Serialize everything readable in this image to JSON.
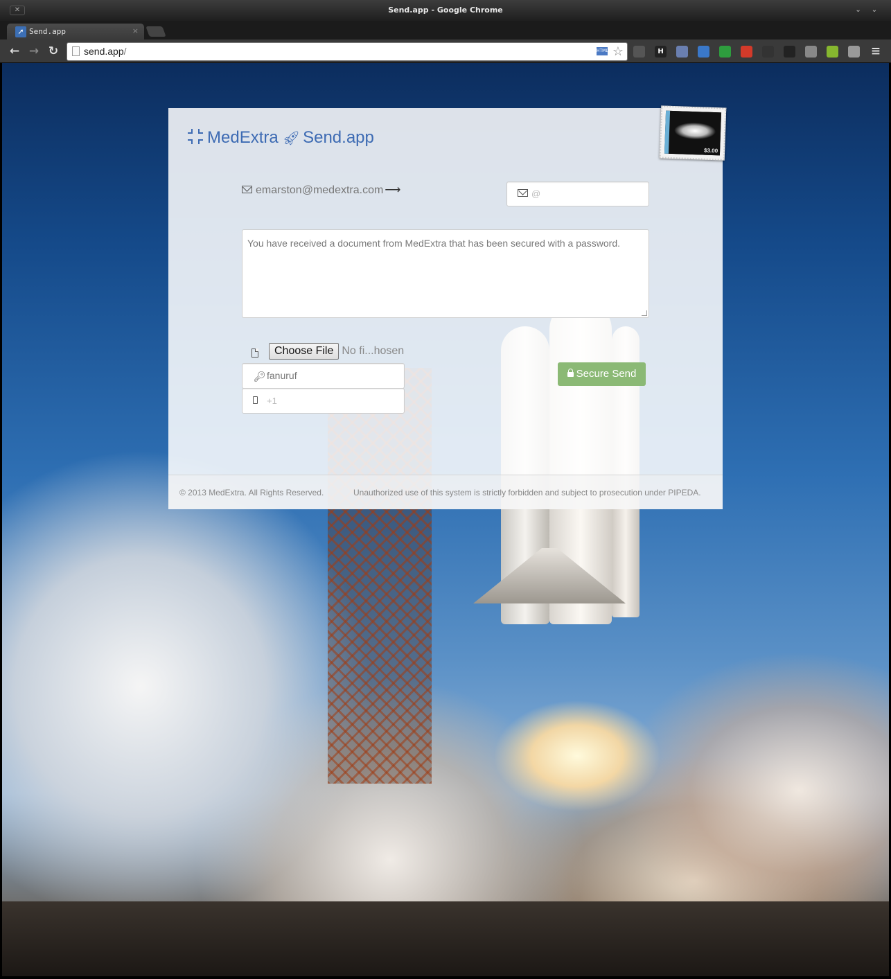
{
  "window": {
    "title": "Send.app - Google Chrome",
    "close_glyph": "✕",
    "min_glyph": "⌄",
    "max_glyph": "⌄"
  },
  "tabs": [
    {
      "title": "Send.app",
      "close": "×",
      "favicon": "rocket-favicon"
    }
  ],
  "toolbar": {
    "back": "←",
    "forward": "→",
    "reload": "↻",
    "url_host": "send.app",
    "url_path": "/",
    "star": "☆",
    "menu": "≡",
    "extensions": [
      {
        "icon": "recycle-icon",
        "color": "#555555"
      },
      {
        "icon": "h-extension-icon",
        "label": "H",
        "color": "#222222"
      },
      {
        "icon": "printer-icon",
        "color": "#6a7fb0"
      },
      {
        "icon": "window-icon",
        "color": "#3a78c9"
      },
      {
        "icon": "badge-green-icon",
        "color": "#2e9d3e"
      },
      {
        "icon": "puzzle-icon",
        "color": "#d33a2a"
      },
      {
        "icon": "clock-icon",
        "color": "#333333"
      },
      {
        "icon": "circle-arrow-icon",
        "color": "#222222"
      },
      {
        "icon": "bar-icon",
        "color": "#888888"
      },
      {
        "icon": "android-icon",
        "color": "#86b72f"
      },
      {
        "icon": "globe-icon",
        "color": "#999999"
      }
    ]
  },
  "brand": {
    "company": "MedExtra",
    "app": "Send.app",
    "accent": "#3d6bb3"
  },
  "form": {
    "from_email": "emarston@medextra.com",
    "from_arrow": "⟶",
    "to_placeholder": "@",
    "message": "You have received a document from MedExtra that has been secured with a password.",
    "choose_file_label": "Choose File",
    "no_file_text": "No fi...hosen",
    "password_value": "fanuruf",
    "phone_placeholder": "+1",
    "send_label": "Secure Send",
    "send_color": "#8bb975"
  },
  "footer": {
    "copyright": "© 2013 MedExtra. All Rights Reserved.",
    "legal": "Unauthorized use of this system is strictly forbidden and subject to prosecution under PIPEDA."
  },
  "stamp": {
    "value": "$3.00"
  }
}
